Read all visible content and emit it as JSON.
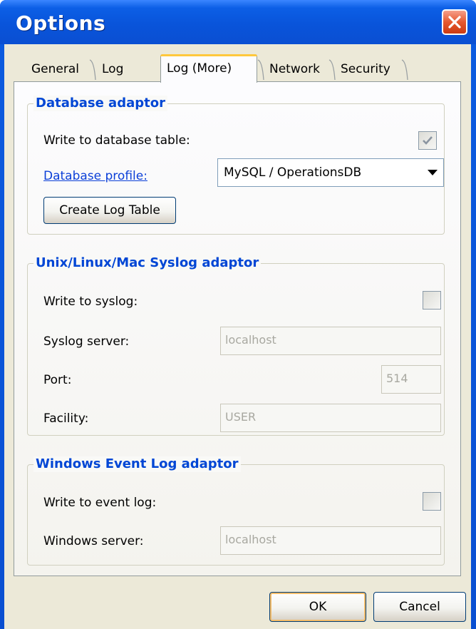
{
  "window": {
    "title": "Options"
  },
  "tabs": [
    {
      "label": "General"
    },
    {
      "label": "Log"
    },
    {
      "label": "Log (More)",
      "active": true
    },
    {
      "label": "Network"
    },
    {
      "label": "Security"
    }
  ],
  "database": {
    "legend": "Database adaptor",
    "write_label": "Write to database table:",
    "write_checked": true,
    "profile_label": "Database profile:",
    "profile_value": "MySQL / OperationsDB",
    "create_button": "Create Log Table"
  },
  "syslog": {
    "legend": "Unix/Linux/Mac Syslog adaptor",
    "write_label": "Write to syslog:",
    "write_checked": false,
    "server_label": "Syslog server:",
    "server_value": "localhost",
    "port_label": "Port:",
    "port_value": "514",
    "facility_label": "Facility:",
    "facility_value": "USER"
  },
  "eventlog": {
    "legend": "Windows Event Log adaptor",
    "write_label": "Write to event log:",
    "write_checked": false,
    "server_label": "Windows server:",
    "server_value": "localhost"
  },
  "footer": {
    "ok_label": "OK",
    "cancel_label": "Cancel"
  },
  "colors": {
    "titlebar": "#0a4fd2",
    "legend": "#0046d5",
    "dialog_bg": "#ece9d8"
  }
}
